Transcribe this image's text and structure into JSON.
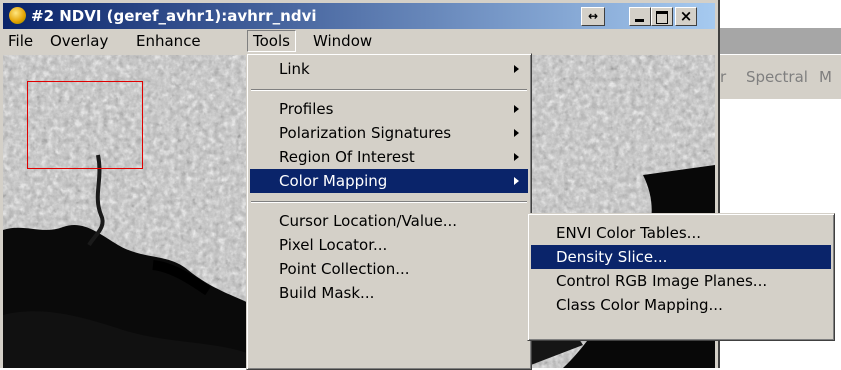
{
  "window": {
    "title": "#2 NDVI (geref_avhr1):avhrr_ndvi",
    "buttons": {
      "resize": "↔",
      "minimize": "_",
      "maximize": "□",
      "close": "×"
    }
  },
  "menubar": [
    "File",
    "Overlay",
    "Enhance",
    "Tools",
    "Window"
  ],
  "background_window": {
    "menu": [
      "r",
      "Spectral",
      "M"
    ]
  },
  "tools_menu": {
    "items": [
      {
        "label": "Link",
        "submenu": true
      },
      {
        "label": "Profiles",
        "submenu": true
      },
      {
        "label": "Polarization Signatures",
        "submenu": true
      },
      {
        "label": "Region Of Interest",
        "submenu": true
      },
      {
        "label": "Color Mapping",
        "submenu": true,
        "selected": true
      },
      {
        "label": "Cursor Location/Value..."
      },
      {
        "label": "Pixel Locator..."
      },
      {
        "label": "Point Collection..."
      },
      {
        "label": "Build Mask..."
      }
    ]
  },
  "color_mapping_submenu": {
    "items": [
      {
        "label": "ENVI Color Tables..."
      },
      {
        "label": "Density Slice...",
        "selected": true
      },
      {
        "label": "Control RGB Image Planes..."
      },
      {
        "label": "Class Color Mapping..."
      }
    ]
  }
}
